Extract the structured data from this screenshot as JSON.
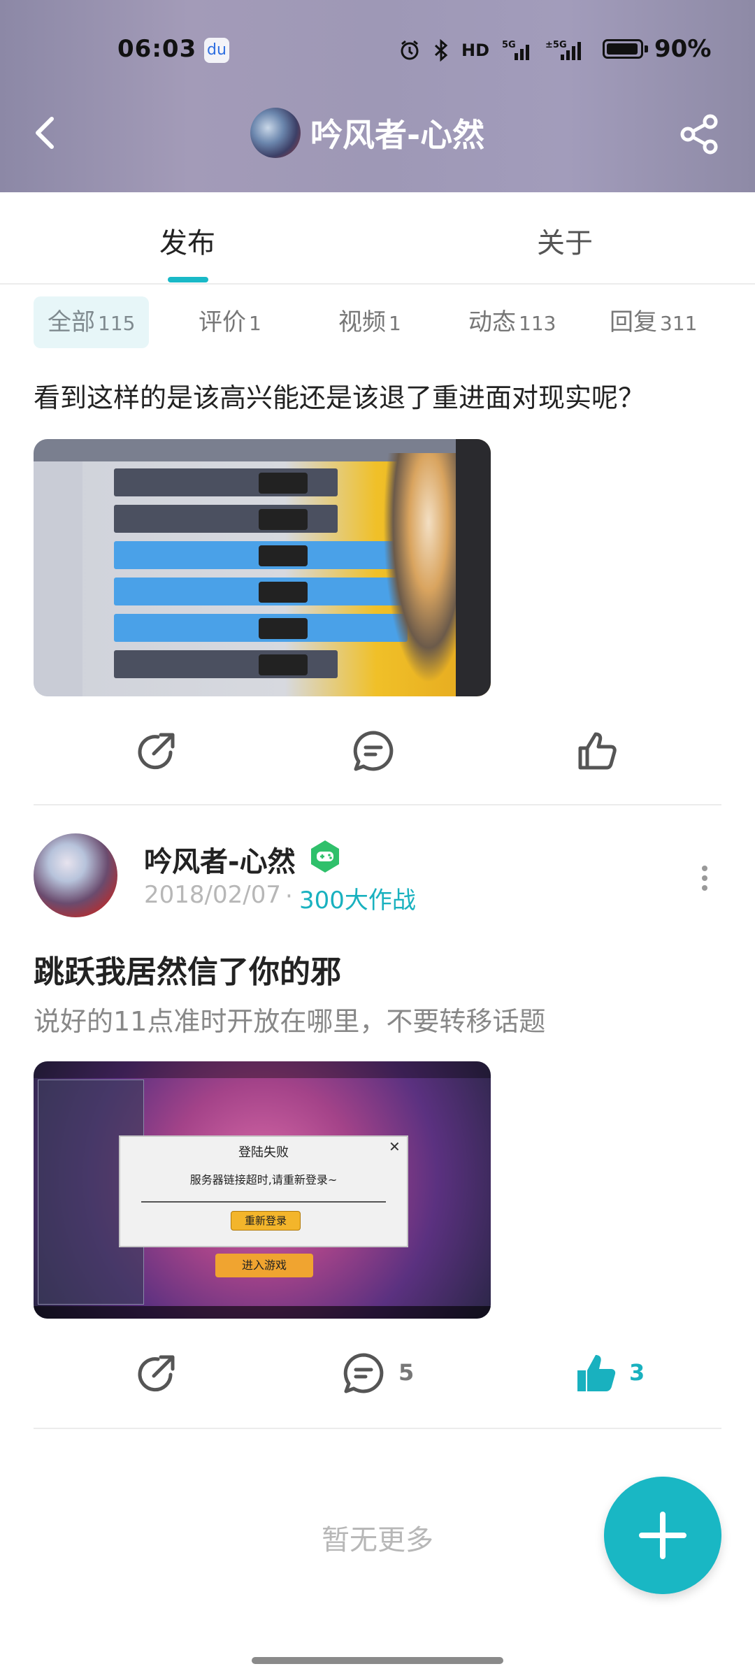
{
  "status": {
    "time": "06:03",
    "battery": "90%",
    "icons": [
      "alarm-icon",
      "bluetooth-icon",
      "hd-icon",
      "signal-5g-icon",
      "signal-5g-icon"
    ]
  },
  "header": {
    "title": "吟风者-心然"
  },
  "tabs": [
    {
      "label": "发布",
      "active": true
    },
    {
      "label": "关于",
      "active": false
    }
  ],
  "filters": [
    {
      "label": "全部",
      "count": "115",
      "active": true
    },
    {
      "label": "评价",
      "count": "1"
    },
    {
      "label": "视频",
      "count": "1"
    },
    {
      "label": "动态",
      "count": "113"
    },
    {
      "label": "回复",
      "count": "311"
    }
  ],
  "post1": {
    "text": "看到这样的是该高兴能还是该退了重进面对现实呢？"
  },
  "post2": {
    "author": "吟风者-心然",
    "date": "2018/02/07",
    "separator": "·",
    "game": "300大作战",
    "title": "跳跃我居然信了你的邪",
    "subtitle": "说好的11点准时开放在哪里，不要转移话题",
    "comments": "5",
    "likes": "3",
    "image": {
      "dialog_title": "登陆失败",
      "dialog_message": "服务器链接超时,请重新登录~",
      "dialog_button": "重新登录",
      "enter_button": "进入游戏"
    }
  },
  "footer": {
    "empty_text": "暂无更多"
  },
  "colors": {
    "accent": "#19b7c4",
    "like_active": "#19b1bf"
  }
}
